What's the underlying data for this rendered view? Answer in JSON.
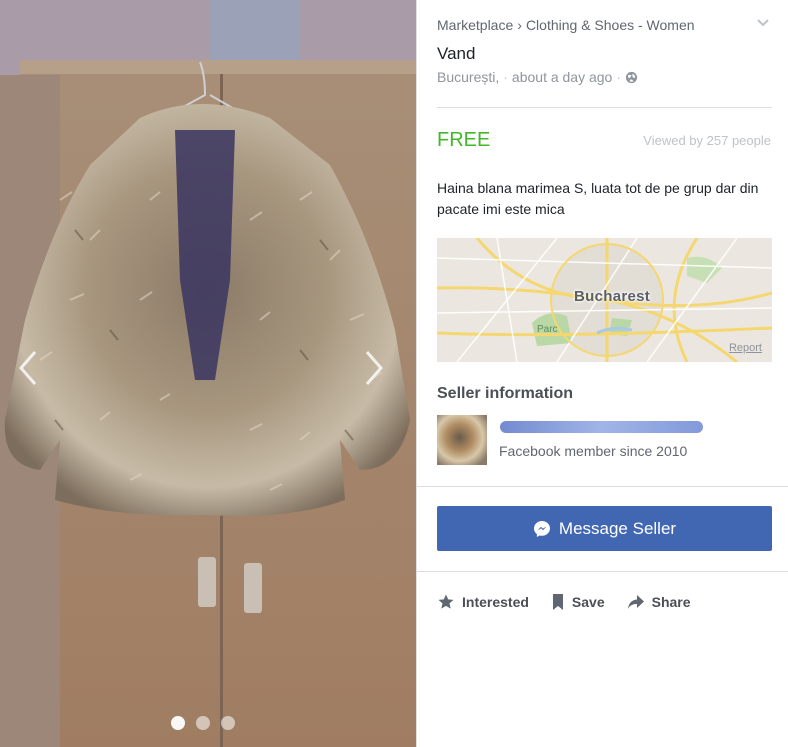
{
  "photo": {
    "prev_icon": "chevron-left-icon",
    "next_icon": "chevron-right-icon",
    "slide_count": 3,
    "active_slide": 1
  },
  "breadcrumb": {
    "root": "Marketplace",
    "separator": "›",
    "category": "Clothing & Shoes - Women"
  },
  "listing": {
    "title": "Vand",
    "location": "București,",
    "meta_sep": "·",
    "posted": "about a day ago",
    "visibility_icon": "globe-icon",
    "price": "FREE",
    "views": "Viewed by 257 people",
    "description": "Haina blana marimea S, luata tot de pe grup dar din pacate imi este mica"
  },
  "map": {
    "city_label": "Bucharest",
    "park_label": "Parc",
    "report_label": "Report"
  },
  "seller": {
    "heading": "Seller information",
    "member_since": "Facebook member since 2010"
  },
  "message_button": {
    "label": "Message Seller",
    "icon": "messenger-icon"
  },
  "actions": [
    {
      "label": "Interested",
      "icon": "star-icon"
    },
    {
      "label": "Save",
      "icon": "bookmark-icon"
    },
    {
      "label": "Share",
      "icon": "share-icon"
    }
  ],
  "colors": {
    "price_green": "#42b72a",
    "button_blue": "#4267b2",
    "muted_text": "#90949c"
  }
}
